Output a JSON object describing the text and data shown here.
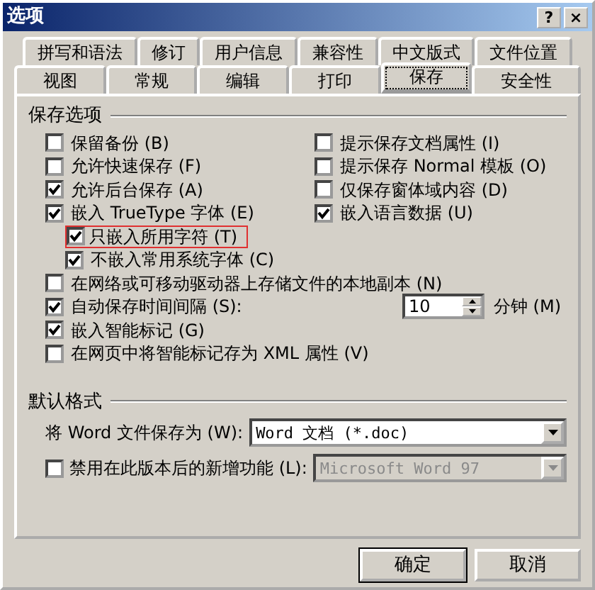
{
  "window": {
    "title": "选项",
    "help_button": "?",
    "close_button": "×"
  },
  "tab_rows": [
    [
      {
        "label": "拼写和语法",
        "selected": false
      },
      {
        "label": "修订",
        "selected": false
      },
      {
        "label": "用户信息",
        "selected": false
      },
      {
        "label": "兼容性",
        "selected": false
      },
      {
        "label": "中文版式",
        "selected": false
      },
      {
        "label": "文件位置",
        "selected": false
      }
    ],
    [
      {
        "label": "视图",
        "selected": false
      },
      {
        "label": "常规",
        "selected": false
      },
      {
        "label": "编辑",
        "selected": false
      },
      {
        "label": "打印",
        "selected": false
      },
      {
        "label": "保存",
        "selected": true
      },
      {
        "label": "安全性",
        "selected": false
      }
    ]
  ],
  "save_options": {
    "title": "保存选项",
    "left": [
      {
        "label": "保留备份 (B)",
        "checked": false,
        "highlighted": false
      },
      {
        "label": "允许快速保存 (F)",
        "checked": false,
        "highlighted": false
      },
      {
        "label": "允许后台保存 (A)",
        "checked": true,
        "highlighted": false
      },
      {
        "label": "嵌入 TrueType 字体 (E)",
        "checked": true,
        "highlighted": false,
        "children": [
          {
            "label": "只嵌入所用字符 (T)",
            "checked": true,
            "highlighted": true
          },
          {
            "label": "不嵌入常用系统字体 (C)",
            "checked": true,
            "highlighted": false
          }
        ]
      }
    ],
    "right": [
      {
        "label": "提示保存文档属性 (I)",
        "checked": false,
        "highlighted": false
      },
      {
        "label": "提示保存 Normal 模板 (O)",
        "checked": false,
        "highlighted": false
      },
      {
        "label": "仅保存窗体域内容 (D)",
        "checked": false,
        "highlighted": false
      },
      {
        "label": "嵌入语言数据 (U)",
        "checked": true,
        "highlighted": false
      }
    ],
    "below": [
      {
        "kind": "checkbox",
        "label": "在网络或可移动驱动器上存储文件的本地副本 (N)",
        "checked": false,
        "highlighted": false
      },
      {
        "kind": "spinner",
        "label": "自动保存时间间隔 (S):",
        "checked": true,
        "highlighted": false,
        "value": "10",
        "unit": "分钟 (M)"
      },
      {
        "kind": "checkbox",
        "label": "嵌入智能标记 (G)",
        "checked": true,
        "highlighted": false
      },
      {
        "kind": "checkbox",
        "label": "在网页中将智能标记存为 XML 属性 (V)",
        "checked": false,
        "highlighted": false
      }
    ]
  },
  "default_format": {
    "title": "默认格式",
    "save_as": {
      "label": "将 Word 文件保存为 (W):",
      "value": "Word 文档 (*.doc)",
      "disabled": false
    },
    "disable_features": {
      "label": "禁用在此版本后的新增功能 (L):",
      "checked": false,
      "value": "Microsoft Word 97",
      "disabled": true
    }
  },
  "buttons": [
    {
      "label": "确定",
      "default": true
    },
    {
      "label": "取消",
      "default": false
    }
  ]
}
